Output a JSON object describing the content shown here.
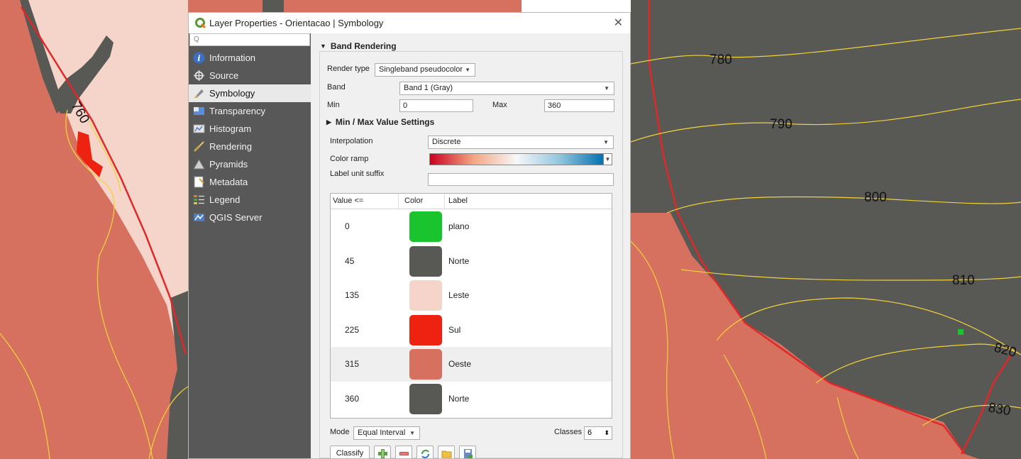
{
  "map": {
    "contour_labels": [
      "760",
      "780",
      "790",
      "800",
      "810",
      "820",
      "830"
    ],
    "colors": {
      "plano": "#19c42e",
      "norte": "#585855",
      "leste": "#f5d5ca",
      "sul": "#ee2211",
      "oeste": "#d6705f",
      "contour": "#f2d23a",
      "boundary": "#e02828"
    }
  },
  "dialog": {
    "title": "Layer Properties - Orientacao | Symbology",
    "close_icon": "close-icon",
    "search_placeholder": "Q"
  },
  "sidebar": {
    "items": [
      {
        "label": "Information",
        "icon": "information-icon"
      },
      {
        "label": "Source",
        "icon": "source-icon"
      },
      {
        "label": "Symbology",
        "icon": "symbology-icon",
        "active": true
      },
      {
        "label": "Transparency",
        "icon": "transparency-icon"
      },
      {
        "label": "Histogram",
        "icon": "histogram-icon"
      },
      {
        "label": "Rendering",
        "icon": "rendering-icon"
      },
      {
        "label": "Pyramids",
        "icon": "pyramids-icon"
      },
      {
        "label": "Metadata",
        "icon": "metadata-icon"
      },
      {
        "label": "Legend",
        "icon": "legend-icon"
      },
      {
        "label": "QGIS Server",
        "icon": "qgis-server-icon"
      }
    ]
  },
  "symbology": {
    "section_title": "Band Rendering",
    "render_type_label": "Render type",
    "render_type_value": "Singleband pseudocolor",
    "band_label": "Band",
    "band_value": "Band 1 (Gray)",
    "min_label": "Min",
    "min_value": "0",
    "max_label": "Max",
    "max_value": "360",
    "minmax_section": "Min / Max Value Settings",
    "interpolation_label": "Interpolation",
    "interpolation_value": "Discrete",
    "color_ramp_label": "Color ramp",
    "color_ramp_stops": [
      "#ca0020",
      "#f4a582",
      "#f7f7f7",
      "#92c5de",
      "#0571b0"
    ],
    "label_unit_suffix_label": "Label unit suffix",
    "label_unit_suffix_value": "",
    "table": {
      "headers": [
        "Value <=",
        "Color",
        "Label"
      ],
      "rows": [
        {
          "value": "0",
          "color": "#19c42e",
          "label": "plano"
        },
        {
          "value": "45",
          "color": "#585855",
          "label": "Norte"
        },
        {
          "value": "135",
          "color": "#f5d5ca",
          "label": "Leste"
        },
        {
          "value": "225",
          "color": "#ee2211",
          "label": "Sul"
        },
        {
          "value": "315",
          "color": "#d6705f",
          "label": "Oeste"
        },
        {
          "value": "360",
          "color": "#585855",
          "label": "Norte"
        }
      ]
    },
    "mode_label": "Mode",
    "mode_value": "Equal Interval",
    "classes_label": "Classes",
    "classes_value": "6",
    "classify_label": "Classify",
    "tool_buttons": [
      "add-class-icon",
      "remove-class-icon",
      "reverse-colors-icon",
      "load-file-icon",
      "save-file-icon"
    ]
  }
}
